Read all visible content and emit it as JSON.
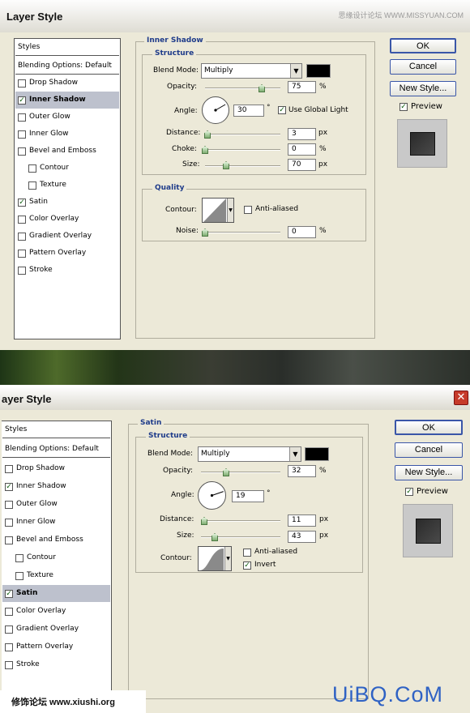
{
  "dialog1": {
    "title": "Layer Style",
    "watermark_top": "思缘设计论坛 WWW.MISSYUAN.COM",
    "styles_header": "Styles",
    "blending_options": "Blending Options: Default",
    "items": [
      {
        "label": "Drop Shadow",
        "checked": false,
        "selected": false,
        "indent": false
      },
      {
        "label": "Inner Shadow",
        "checked": true,
        "selected": true,
        "indent": false
      },
      {
        "label": "Outer Glow",
        "checked": false,
        "selected": false,
        "indent": false
      },
      {
        "label": "Inner Glow",
        "checked": false,
        "selected": false,
        "indent": false
      },
      {
        "label": "Bevel and Emboss",
        "checked": false,
        "selected": false,
        "indent": false
      },
      {
        "label": "Contour",
        "checked": false,
        "selected": false,
        "indent": true
      },
      {
        "label": "Texture",
        "checked": false,
        "selected": false,
        "indent": true
      },
      {
        "label": "Satin",
        "checked": true,
        "selected": false,
        "indent": false
      },
      {
        "label": "Color Overlay",
        "checked": false,
        "selected": false,
        "indent": false
      },
      {
        "label": "Gradient Overlay",
        "checked": false,
        "selected": false,
        "indent": false
      },
      {
        "label": "Pattern Overlay",
        "checked": false,
        "selected": false,
        "indent": false
      },
      {
        "label": "Stroke",
        "checked": false,
        "selected": false,
        "indent": false
      }
    ],
    "section_title": "Inner Shadow",
    "structure_title": "Structure",
    "blend_mode_label": "Blend Mode:",
    "blend_mode_value": "Multiply",
    "blend_color": "#000000",
    "opacity_label": "Opacity:",
    "opacity_value": "75",
    "opacity_unit": "%",
    "opacity_level": 0.75,
    "angle_label": "Angle:",
    "angle_value": "30",
    "angle_unit": "°",
    "angle_degrees": 30,
    "use_global_light_label": "Use Global Light",
    "use_global_light_checked": true,
    "distance_label": "Distance:",
    "distance_value": "3",
    "distance_unit": "px",
    "distance_level": 0.03,
    "choke_label": "Choke:",
    "choke_value": "0",
    "choke_unit": "%",
    "choke_level": 0,
    "size_label": "Size:",
    "size_value": "70",
    "size_unit": "px",
    "size_level": 0.28,
    "quality_title": "Quality",
    "contour_label": "Contour:",
    "anti_aliased_label": "Anti-aliased",
    "anti_aliased_checked": false,
    "noise_label": "Noise:",
    "noise_value": "0",
    "noise_unit": "%",
    "noise_level": 0,
    "ok_label": "OK",
    "cancel_label": "Cancel",
    "new_style_label": "New Style...",
    "preview_label": "Preview",
    "preview_checked": true
  },
  "dialog2": {
    "title": "ayer Style",
    "styles_header": "Styles",
    "blending_options": "Blending Options: Default",
    "items": [
      {
        "label": "Drop Shadow",
        "checked": false,
        "selected": false,
        "indent": false
      },
      {
        "label": "Inner Shadow",
        "checked": true,
        "selected": false,
        "indent": false
      },
      {
        "label": "Outer Glow",
        "checked": false,
        "selected": false,
        "indent": false
      },
      {
        "label": "Inner Glow",
        "checked": false,
        "selected": false,
        "indent": false
      },
      {
        "label": "Bevel and Emboss",
        "checked": false,
        "selected": false,
        "indent": false
      },
      {
        "label": "Contour",
        "checked": false,
        "selected": false,
        "indent": true
      },
      {
        "label": "Texture",
        "checked": false,
        "selected": false,
        "indent": true
      },
      {
        "label": "Satin",
        "checked": true,
        "selected": true,
        "indent": false
      },
      {
        "label": "Color Overlay",
        "checked": false,
        "selected": false,
        "indent": false
      },
      {
        "label": "Gradient Overlay",
        "checked": false,
        "selected": false,
        "indent": false
      },
      {
        "label": "Pattern Overlay",
        "checked": false,
        "selected": false,
        "indent": false
      },
      {
        "label": "Stroke",
        "checked": false,
        "selected": false,
        "indent": false
      }
    ],
    "section_title": "Satin",
    "structure_title": "Structure",
    "blend_mode_label": "Blend Mode:",
    "blend_mode_value": "Multiply",
    "blend_color": "#000000",
    "opacity_label": "Opacity:",
    "opacity_value": "32",
    "opacity_unit": "%",
    "opacity_level": 0.32,
    "angle_label": "Angle:",
    "angle_value": "19",
    "angle_unit": "°",
    "angle_degrees": 19,
    "distance_label": "Distance:",
    "distance_value": "11",
    "distance_unit": "px",
    "distance_level": 0.04,
    "size_label": "Size:",
    "size_value": "43",
    "size_unit": "px",
    "size_level": 0.17,
    "contour_label": "Contour:",
    "anti_aliased_label": "Anti-aliased",
    "anti_aliased_checked": false,
    "invert_label": "Invert",
    "invert_checked": true,
    "ok_label": "OK",
    "cancel_label": "Cancel",
    "new_style_label": "New Style...",
    "preview_label": "Preview",
    "preview_checked": true,
    "watermark_left": "修饰论坛 www.xiushi.org",
    "watermark_right": "UiBQ.CoM"
  }
}
